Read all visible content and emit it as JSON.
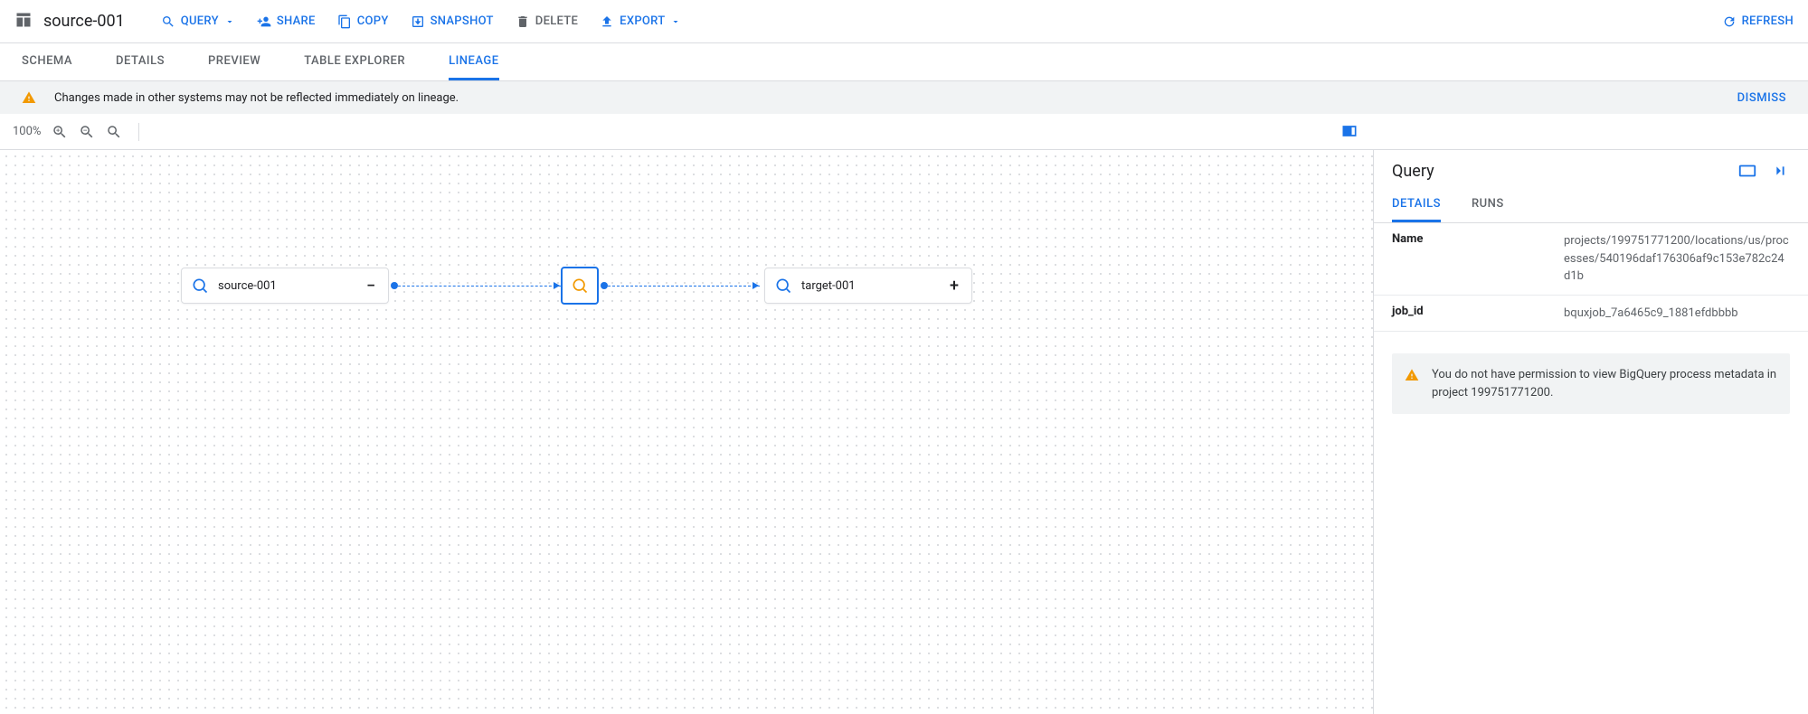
{
  "header": {
    "title": "source-001",
    "actions": {
      "query": "QUERY",
      "share": "SHARE",
      "copy": "COPY",
      "snapshot": "SNAPSHOT",
      "delete": "DELETE",
      "export": "EXPORT",
      "refresh": "REFRESH"
    }
  },
  "tabs": {
    "schema": "SCHEMA",
    "details": "DETAILS",
    "preview": "PREVIEW",
    "table_explorer": "TABLE EXPLORER",
    "lineage": "LINEAGE"
  },
  "notice": {
    "text": "Changes made in other systems may not be reflected immediately on lineage.",
    "dismiss": "DISMISS"
  },
  "zoom": {
    "level": "100%"
  },
  "lineage": {
    "source": "source-001",
    "target": "target-001"
  },
  "sidepanel": {
    "title": "Query",
    "tabs": {
      "details": "DETAILS",
      "runs": "RUNS"
    },
    "rows": {
      "name_key": "Name",
      "name_val": "projects/199751771200/locations/us/processes/540196daf176306af9c153e782c24d1b",
      "jobid_key": "job_id",
      "jobid_val": "bquxjob_7a6465c9_1881efdbbbb"
    },
    "permission_warning": "You do not have permission to view BigQuery process metadata in project 199751771200."
  }
}
